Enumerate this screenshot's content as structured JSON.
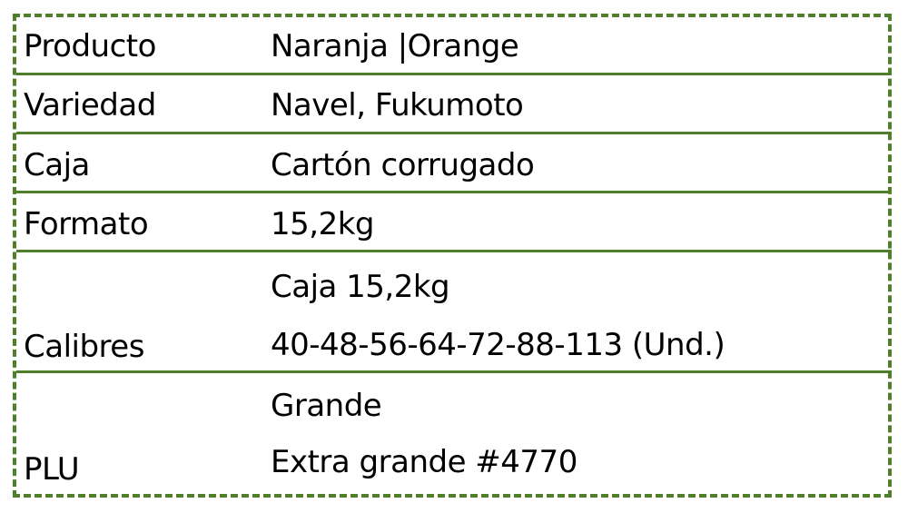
{
  "colors": {
    "border": "#4f7f2a",
    "text": "#000000",
    "background": "#ffffff"
  },
  "rows": [
    {
      "label": "Producto",
      "values": [
        "Naranja |Orange"
      ]
    },
    {
      "label": "Variedad",
      "values": [
        "Navel, Fukumoto"
      ]
    },
    {
      "label": "Caja",
      "values": [
        "Cartón corrugado"
      ]
    },
    {
      "label": "Formato",
      "values": [
        "15,2kg"
      ]
    },
    {
      "label": "Calibres",
      "values": [
        "Caja 15,2kg",
        "40-48-56-64-72-88-113 (Und.)"
      ]
    },
    {
      "label": "PLU",
      "values": [
        "Grande",
        "Extra grande #4770"
      ]
    }
  ]
}
